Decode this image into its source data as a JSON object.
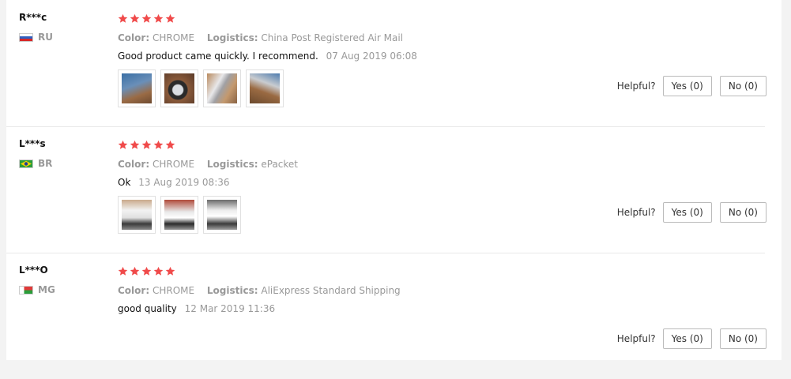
{
  "reviews": [
    {
      "username": "R***c",
      "country_code": "RU",
      "flag": "russia-flag",
      "rating_stars": 5,
      "color_key": "Color:",
      "color_value": "CHROME",
      "logistics_key": "Logistics:",
      "logistics_value": "China Post Registered Air Mail",
      "text": "Good product came quickly. I recommend.",
      "date": "07 Aug 2019 06:08",
      "photo_count": 4,
      "helpful_label": "Helpful?",
      "yes_label": "Yes (0)",
      "no_label": "No (0)"
    },
    {
      "username": "L***s",
      "country_code": "BR",
      "flag": "brazil-flag",
      "rating_stars": 5,
      "color_key": "Color:",
      "color_value": "CHROME",
      "logistics_key": "Logistics:",
      "logistics_value": "ePacket",
      "text": "Ok",
      "date": "13 Aug 2019 08:36",
      "photo_count": 3,
      "helpful_label": "Helpful?",
      "yes_label": "Yes (0)",
      "no_label": "No (0)"
    },
    {
      "username": "L***O",
      "country_code": "MG",
      "flag": "madagascar-flag",
      "rating_stars": 5,
      "color_key": "Color:",
      "color_value": "CHROME",
      "logistics_key": "Logistics:",
      "logistics_value": "AliExpress Standard Shipping",
      "text": "good quality",
      "date": "12 Mar 2019 11:36",
      "photo_count": 0,
      "helpful_label": "Helpful?",
      "yes_label": "Yes (0)",
      "no_label": "No (0)"
    }
  ],
  "colors": {
    "star": "#f04a4a",
    "muted_text": "#999999",
    "divider": "#e8e8e8"
  }
}
